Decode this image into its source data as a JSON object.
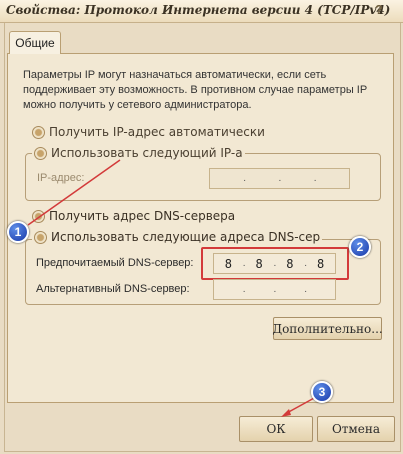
{
  "window": {
    "title": "Свойства: Протокол Интернета версии 4 (TCP/IPv4)",
    "help_glyph": "?"
  },
  "tabs": [
    {
      "label": "Общие"
    }
  ],
  "description": "Параметры IP могут назначаться автоматически, если сеть поддерживает эту возможность. В противном случае параметры IP можно получить у сетевого администратора.",
  "ip_section": {
    "auto_label": "Получить IP-адрес автоматически",
    "manual_label": "Использовать следующий IP-а",
    "ip_address_label": "IP-адрес:",
    "ip_address_value": [
      "",
      "",
      "",
      ""
    ]
  },
  "dns_section": {
    "auto_label": "Получить адрес DNS-сервера",
    "manual_label": "Использовать следующие адреса DNS-сер",
    "preferred_label": "Предпочитаемый DNS-сервер:",
    "preferred_value": [
      "8",
      "8",
      "8",
      "8"
    ],
    "alternate_label": "Альтернативный DNS-сервер:",
    "alternate_value": [
      "",
      "",
      "",
      ""
    ]
  },
  "buttons": {
    "advanced_label": "Дополнительно...",
    "ok_label": "ОК",
    "cancel_label": "Отмена"
  },
  "annotations": {
    "badge_1": "1",
    "badge_2": "2",
    "badge_3": "3",
    "accent_color": "#d33a3a",
    "badge_color": "#1f47b8"
  }
}
